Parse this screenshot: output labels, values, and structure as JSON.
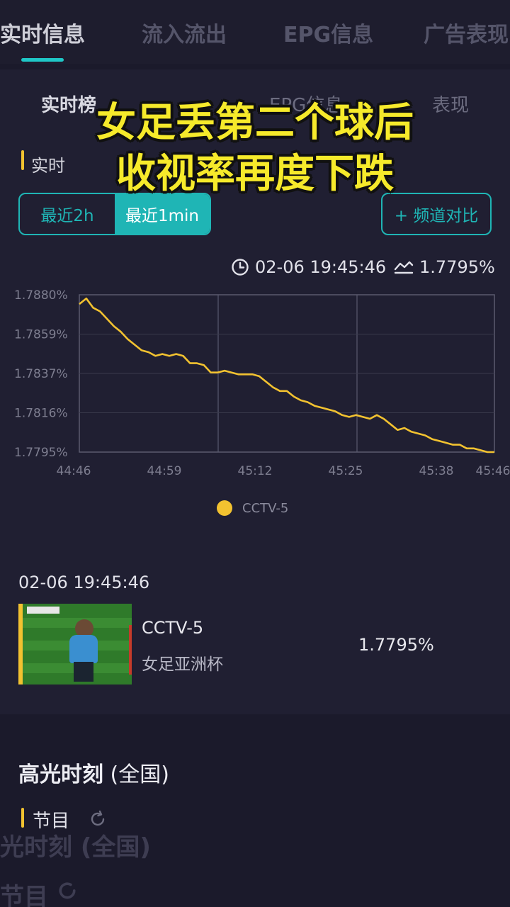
{
  "top_tabs": [
    {
      "label": "实时信息"
    },
    {
      "label": "流入流出"
    },
    {
      "label": "EPG信息"
    },
    {
      "label": "广告表现"
    }
  ],
  "sub_tabs": [
    {
      "label": "实时榜"
    },
    {
      "label": "EPG信息"
    },
    {
      "label": "表现"
    }
  ],
  "section_label": "实时",
  "range_options": [
    {
      "label": "最近2h"
    },
    {
      "label": "最近1min"
    }
  ],
  "compare_button": "+ 频道对比",
  "readout": {
    "timestamp": "02-06 19:45:46",
    "value": "1.7795%"
  },
  "chart_data": {
    "type": "line",
    "ytick_labels": [
      "1.7880%",
      "1.7859%",
      "1.7837%",
      "1.7816%",
      "1.7795%"
    ],
    "xtick_labels": [
      "44:46",
      "44:59",
      "45:12",
      "45:25",
      "45:38",
      "45:46"
    ],
    "ylim": [
      1.7795,
      1.788
    ],
    "x_unit": "seconds after 44:46",
    "xlim": [
      0,
      60
    ],
    "grid": true,
    "legend_position": "bottom",
    "series": [
      {
        "name": "CCTV-5",
        "color": "#f2c230",
        "x": [
          0,
          1,
          2,
          3,
          4,
          5,
          6,
          7,
          8,
          9,
          10,
          11,
          12,
          13,
          14,
          15,
          16,
          17,
          18,
          19,
          20,
          21,
          22,
          23,
          24,
          25,
          26,
          27,
          28,
          29,
          30,
          31,
          32,
          33,
          34,
          35,
          36,
          37,
          38,
          39,
          40,
          41,
          42,
          43,
          44,
          45,
          46,
          47,
          48,
          49,
          50,
          51,
          52,
          53,
          54,
          55,
          56,
          57,
          58,
          59,
          60
        ],
        "y": [
          1.7875,
          1.7878,
          1.7873,
          1.7871,
          1.7867,
          1.7863,
          1.786,
          1.7856,
          1.7853,
          1.785,
          1.7849,
          1.7847,
          1.7848,
          1.7847,
          1.7848,
          1.7847,
          1.7843,
          1.7843,
          1.7842,
          1.7838,
          1.7838,
          1.7839,
          1.7838,
          1.7837,
          1.7837,
          1.7837,
          1.7836,
          1.7833,
          1.783,
          1.7828,
          1.7828,
          1.7825,
          1.7823,
          1.7822,
          1.782,
          1.7819,
          1.7818,
          1.7817,
          1.7815,
          1.7814,
          1.7815,
          1.7814,
          1.7813,
          1.7815,
          1.7813,
          1.781,
          1.7807,
          1.7808,
          1.7806,
          1.7805,
          1.7804,
          1.7802,
          1.7801,
          1.78,
          1.7799,
          1.7799,
          1.7797,
          1.7797,
          1.7796,
          1.7795,
          1.7795
        ]
      }
    ]
  },
  "snapshot": {
    "timestamp": "02-06 19:45:46",
    "channel": "CCTV-5",
    "program": "女足亚洲杯",
    "rating": "1.7795%"
  },
  "highlights": {
    "title_main": "高光时刻",
    "title_scope": " (全国)",
    "program_label": "节目"
  },
  "ghost": {
    "line1": "光时刻 (全国)",
    "line2": "节目"
  },
  "caption": {
    "line1": "女足丢第二个球后",
    "line2": "收视率再度下跌"
  }
}
